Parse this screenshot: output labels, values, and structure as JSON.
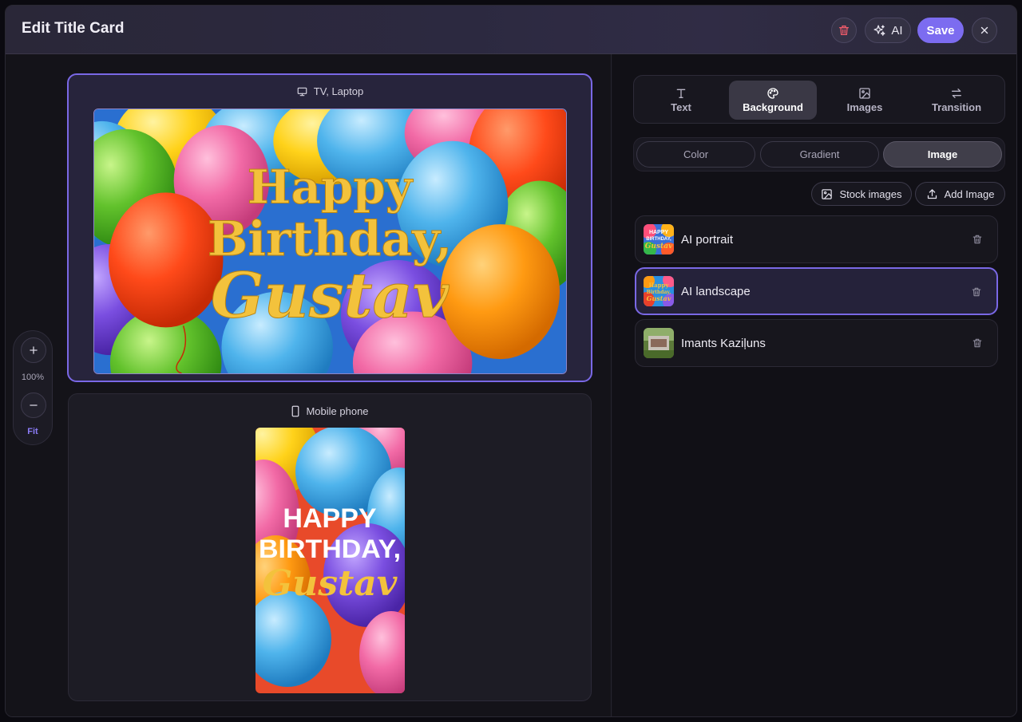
{
  "header": {
    "title": "Edit Title Card",
    "ai_label": "AI",
    "save_label": "Save"
  },
  "zoom": {
    "level": "100%",
    "fit_label": "Fit"
  },
  "previews": {
    "tv": {
      "label": "TV, Laptop",
      "line1": "Happy",
      "line2": "Birthday,",
      "line3": "Gustav"
    },
    "mobile": {
      "label": "Mobile phone",
      "line1": "HAPPY",
      "line2": "BIRTHDAY,",
      "line3": "Gustav"
    }
  },
  "tabs": [
    {
      "label": "Text",
      "icon": "text-icon",
      "active": false
    },
    {
      "label": "Background",
      "icon": "palette-icon",
      "active": true
    },
    {
      "label": "Images",
      "icon": "image-icon",
      "active": false
    },
    {
      "label": "Transition",
      "icon": "transition-arrows-icon",
      "active": false
    }
  ],
  "background_modes": [
    {
      "label": "Color",
      "active": false
    },
    {
      "label": "Gradient",
      "active": false
    },
    {
      "label": "Image",
      "active": true
    }
  ],
  "actions": {
    "stock_label": "Stock images",
    "add_label": "Add Image"
  },
  "images": [
    {
      "name": "AI portrait",
      "selected": false
    },
    {
      "name": "AI landscape",
      "selected": true
    },
    {
      "name": "Imants Kaziļuns",
      "selected": false
    }
  ],
  "colors": {
    "accent": "#7c6cf0",
    "delete": "#ef5b6a",
    "title_gold": "#f3c23c"
  }
}
